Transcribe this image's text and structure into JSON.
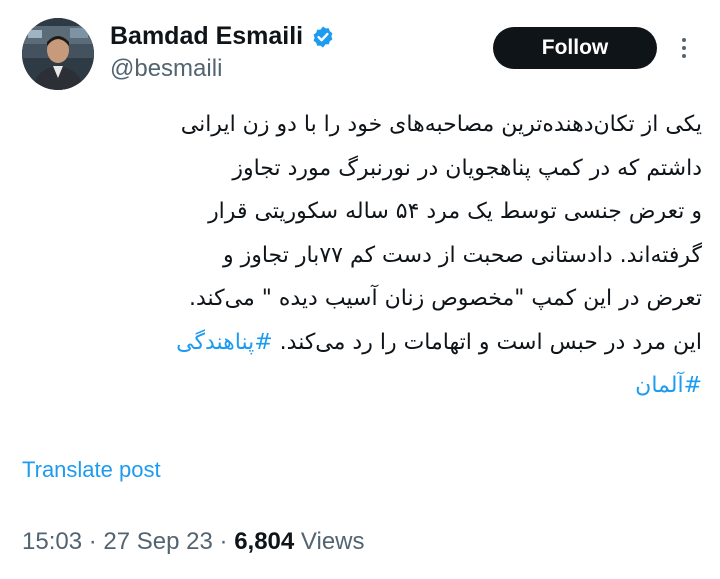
{
  "author": {
    "display_name": "Bamdad Esmaili",
    "handle": "@besmaili",
    "verified": true
  },
  "follow_label": "Follow",
  "tweet": {
    "lines": [
      "یکی از تکان‌دهنده‌ترین مصاحبه‌های خود را با دو زن ایرانی",
      "داشتم که در کمپ پناهجویان در نورنبرگ مورد تجاوز",
      "و تعرض جنسی توسط یک مرد ۵۴ ساله سکوریتی قرار",
      "گرفته‌اند. دادستانی صحبت از دست کم ۷۷بار تجاوز و",
      "تعرض در این کمپ \"مخصوص زنان آسیب دیده \" می‌کند.",
      "این مرد در حبس است و اتهامات را رد می‌کند."
    ],
    "hashtag_1": "#پناهندگی",
    "hashtag_2": "#آلمان"
  },
  "translate_label": "Translate post",
  "meta": {
    "time": "15:03",
    "separator": "·",
    "date": "27 Sep 23",
    "views_count": "6,804",
    "views_label": "Views"
  },
  "colors": {
    "accent": "#1d9bf0",
    "text": "#0f1419",
    "secondary": "#536471",
    "follow_bg": "#0f1419"
  }
}
